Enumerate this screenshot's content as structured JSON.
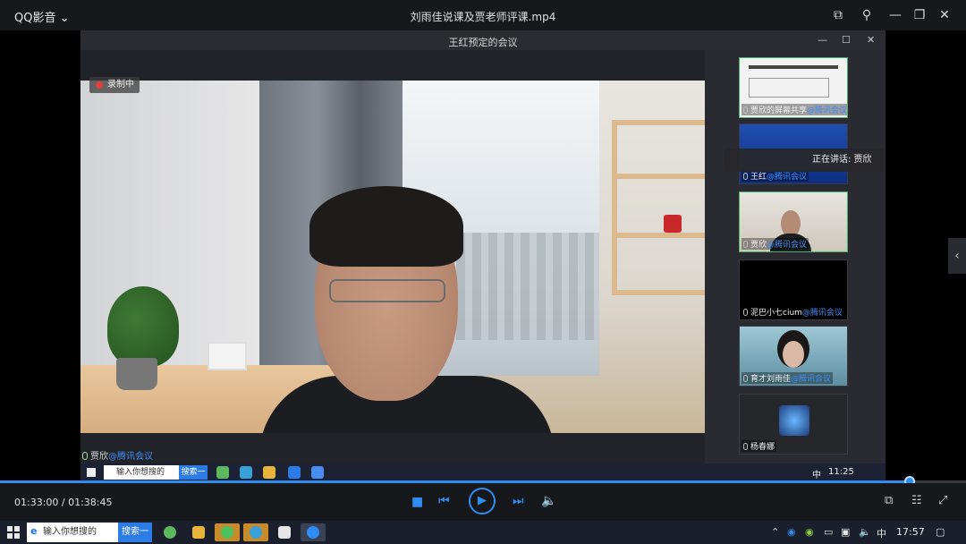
{
  "player": {
    "app_name": "QQ影音",
    "file_title": "刘雨佳说课及贾老师评课.mp4"
  },
  "meeting": {
    "window_title": "王红预定的会议",
    "recording_label": "录制中",
    "speaker_name": "贾欣",
    "speaker_brand": "@腾讯会议",
    "speaking_tip": "正在讲话: 贾欣"
  },
  "participants": [
    {
      "name": "贾欣的屏幕共享",
      "brand": "@腾讯会议"
    },
    {
      "name": "王红",
      "brand": "@腾讯会议"
    },
    {
      "name": "贾欣",
      "brand": "@腾讯会议"
    },
    {
      "name": "泥巴小七cium",
      "brand": "@腾讯会议"
    },
    {
      "name": "育才刘雨佳",
      "brand": "@腾讯会议"
    },
    {
      "name": "杨春娜",
      "brand": ""
    }
  ],
  "inner_taskbar": {
    "search_placeholder": "输入你想搜的",
    "search_button": "搜索一下",
    "ime": "中",
    "clock": "11:25"
  },
  "playback": {
    "time_display": "01:33:00 / 01:38:45",
    "progress": 0.942
  },
  "taskbar": {
    "search_placeholder": "输入你想搜的",
    "search_button": "搜索一下",
    "ime": "中",
    "clock": "17:57"
  },
  "colors": {
    "accent": "#2f8cf0",
    "brand_blue": "#3f8df4",
    "active_tile": "#4ab06a",
    "recording": "#e43b3b"
  }
}
